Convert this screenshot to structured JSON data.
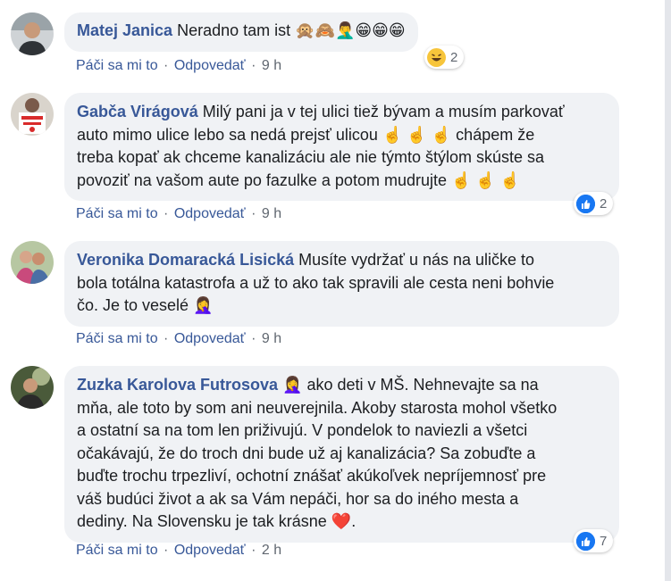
{
  "comments": [
    {
      "author": "Matej Janica",
      "text": "Neradno tam ist 🙊🙈🤦‍♂️😁😁😁",
      "actions": {
        "like": "Páči sa mi to",
        "reply": "Odpovedať",
        "sep": "·",
        "time": "9 h"
      },
      "reaction": {
        "icon": "haha-icon",
        "count": "2"
      }
    },
    {
      "author": "Gabča Virágová",
      "text_lines": [
        "Milý pani ja v tej ulici tiež bývam a musím parkovať",
        "auto mimo ulice lebo sa nedá prejsť ulicou ☝️ ☝️ ☝️ chápem že",
        "treba kopať ak chceme kanalizáciu ale nie týmto štýlom skúste sa",
        "povoziť na vašom aute po fazulke a potom mudrujte ☝️ ☝️ ☝️"
      ],
      "actions": {
        "like": "Páči sa mi to",
        "reply": "Odpovedať",
        "sep": "·",
        "time": "9 h"
      },
      "reaction": {
        "icon": "like-icon",
        "count": "2"
      }
    },
    {
      "author": "Veronika Domaracká Lisická",
      "text_lines": [
        "Musíte vydržať u nás na uličke to",
        "bola totálna katastrofa a už to ako tak spravili ale cesta neni bohvie",
        "čo. Je to veselé 🤦‍♀️"
      ],
      "actions": {
        "like": "Páči sa mi to",
        "reply": "Odpovedať",
        "sep": "·",
        "time": "9 h"
      }
    },
    {
      "author": "Zuzka Karolova Futrosova",
      "text_lines": [
        "🤦‍♀️ ako deti v MŠ. Nehnevajte sa na",
        "mňa, ale toto by som ani neuverejnila. Akoby starosta mohol všetko",
        "a ostatní sa na tom len priživujú. V pondelok to naviezli a všetci",
        "očakávajú, že do troch dni bude už aj kanalizácia? Sa zobuďte a",
        "buďte trochu trpezliví, ochotní znášať akúkoľvek nepríjemnosť pre",
        "váš budúci život a ak sa Vám nepáči, hor sa do iného mesta a",
        "dediny. Na Slovensku je tak krásne ❤️."
      ],
      "actions": {
        "like": "Páči sa mi to",
        "reply": "Odpovedať",
        "sep": "·",
        "time": "2 h"
      },
      "reaction": {
        "icon": "like-icon",
        "count": "7"
      }
    }
  ],
  "colors": {
    "name": "#385898",
    "bubble": "#f0f2f5",
    "meta": "#606770",
    "like": "#1877f2",
    "heart": "#e41e3f"
  }
}
